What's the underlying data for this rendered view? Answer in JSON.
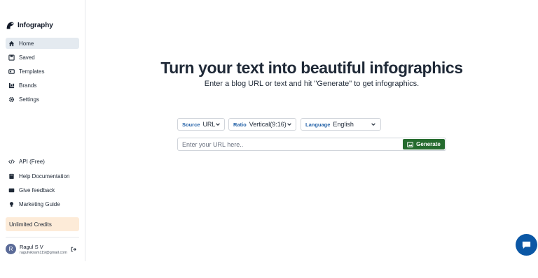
{
  "app": {
    "name": "Infography",
    "brand_color": "#111827"
  },
  "sidebar": {
    "items": [
      {
        "label": "Home",
        "icon": "home-icon",
        "active": true
      },
      {
        "label": "Saved",
        "icon": "save-icon"
      },
      {
        "label": "Templates",
        "icon": "templates-icon"
      },
      {
        "label": "Brands",
        "icon": "brands-icon"
      },
      {
        "label": "Settings",
        "icon": "gear-icon"
      }
    ],
    "bottom_items": [
      {
        "label": "API (Free)",
        "icon": "code-icon"
      },
      {
        "label": "Help Documentation",
        "icon": "book-icon"
      },
      {
        "label": "Give feedback",
        "icon": "feedback-icon"
      },
      {
        "label": "Marketing Guide",
        "icon": "lightbulb-icon"
      }
    ],
    "credits_label": "Unlimited Credits",
    "credits_bg": "#fdebd8"
  },
  "user": {
    "initial": "R",
    "name": "Ragul S V",
    "email": "ragulvikram119@gmail.com"
  },
  "hero": {
    "title": "Turn your text into beautiful infographics",
    "subtitle": "Enter a blog URL or text and hit \"Generate\" to get infographics."
  },
  "controls": {
    "source": {
      "key": "Source",
      "value": "URL"
    },
    "ratio": {
      "key": "Ratio",
      "value": "Vertical(9:16)"
    },
    "language": {
      "key": "Language",
      "value": "English"
    },
    "key_color": "#2563a8"
  },
  "url_input": {
    "placeholder": "Enter your URL here..",
    "value": ""
  },
  "generate_button": {
    "label": "Generate",
    "color": "#256b2e"
  },
  "chat": {
    "icon": "chat-icon",
    "color": "#0b57a5"
  }
}
